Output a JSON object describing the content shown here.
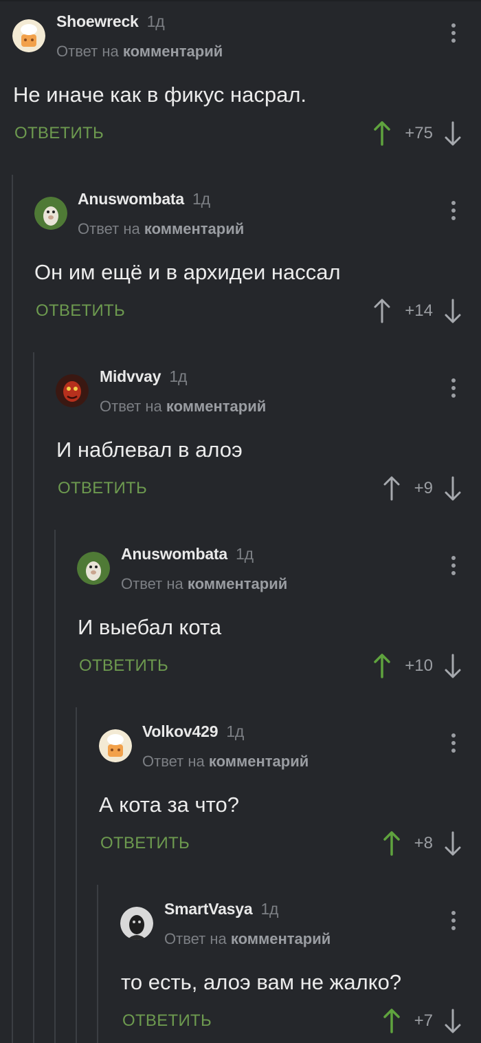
{
  "colors": {
    "background": "#25272b",
    "accent_green": "#6d9a4f",
    "muted_text": "#7c7f84",
    "thread_line": "#3b3e43"
  },
  "reply_label": "ОТВЕТИТЬ",
  "reply_to_prefix": "Ответ на",
  "reply_to_link": "комментарий",
  "comments": [
    {
      "author": "Shoewreck",
      "time": "1д",
      "text": "Не иначе как в фикус насрал.",
      "score": "+75",
      "upvoted": true,
      "avatar": "chef-avatar-icon"
    },
    {
      "author": "Anuswombata",
      "time": "1д",
      "text": "Он им ещё и в архидеи нассал",
      "score": "+14",
      "upvoted": false,
      "avatar": "hamster-avatar-icon"
    },
    {
      "author": "Midvvay",
      "time": "1д",
      "text": "И наблевал в алоэ",
      "score": "+9",
      "upvoted": false,
      "avatar": "red-face-avatar-icon"
    },
    {
      "author": "Anuswombata",
      "time": "1д",
      "text": "И выебал кота",
      "score": "+10",
      "upvoted": true,
      "avatar": "hamster-avatar-icon"
    },
    {
      "author": "Volkov429",
      "time": "1д",
      "text": "А кота за что?",
      "score": "+8",
      "upvoted": true,
      "avatar": "chef-avatar-icon"
    },
    {
      "author": "SmartVasya",
      "time": "1д",
      "text": "то есть, алоэ вам не жалко?",
      "score": "+7",
      "upvoted": true,
      "avatar": "dark-portrait-avatar-icon"
    }
  ]
}
